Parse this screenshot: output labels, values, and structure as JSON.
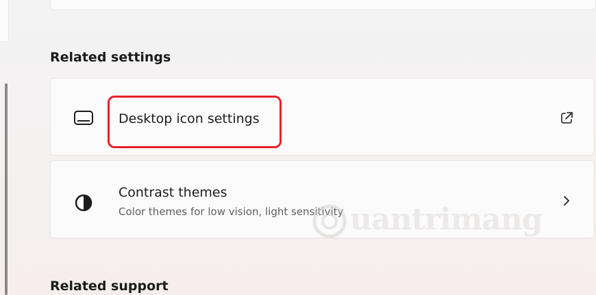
{
  "sections": {
    "related_settings_title": "Related settings",
    "related_support_title": "Related support"
  },
  "cards": {
    "desktop_icon_settings": {
      "label": "Desktop icon settings",
      "icon": "desktop-monitor-icon",
      "action_icon": "external-link-icon"
    },
    "contrast_themes": {
      "label": "Contrast themes",
      "description": "Color themes for low vision, light sensitivity",
      "icon": "contrast-icon",
      "action_icon": "chevron-right-icon"
    }
  },
  "watermark": {
    "text": "uantrimang"
  },
  "colors": {
    "highlight": "#e8202a",
    "text_primary": "#1b1b1b",
    "text_secondary": "#5e5e5e"
  }
}
